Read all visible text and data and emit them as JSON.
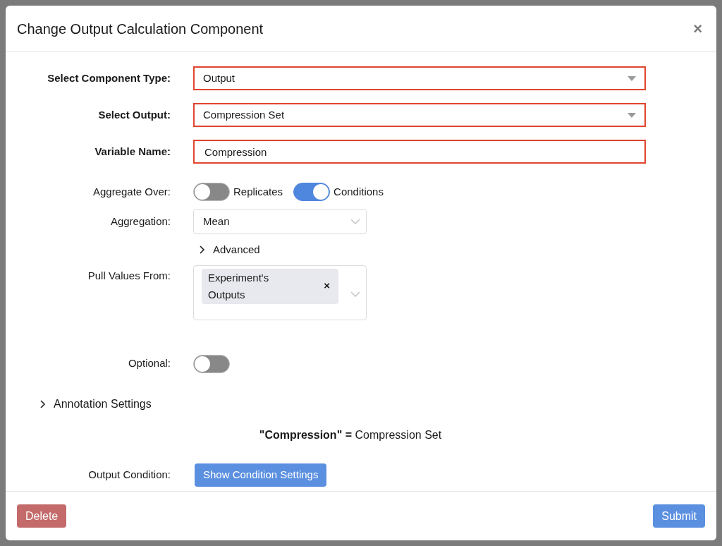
{
  "dialog": {
    "title": "Change Output Calculation Component",
    "close": "×"
  },
  "fields": [
    {
      "kind": "select",
      "label": "Select Component Type:",
      "value": "Output",
      "highlighted": true
    },
    {
      "kind": "select",
      "label": "Select Output:",
      "value": "Compression Set",
      "highlighted": true
    },
    {
      "kind": "input",
      "label": "Variable Name:",
      "value": "Compression",
      "highlighted": true
    },
    {
      "kind": "toggles",
      "label": "Aggregate Over:",
      "toggles": [
        {
          "label": "Replicates",
          "on": false
        },
        {
          "label": "Conditions",
          "on": true
        }
      ]
    },
    {
      "kind": "dropdown",
      "label": "Aggregation:",
      "value": "Mean"
    },
    {
      "kind": "expander",
      "label": "Advanced",
      "expanded": false
    },
    {
      "kind": "multiselect",
      "label": "Pull Values From:",
      "tags": [
        {
          "text": "Experiment's Outputs",
          "remove": "×"
        }
      ]
    },
    {
      "kind": "switch",
      "label": "Optional:",
      "on": false
    }
  ],
  "annotation": {
    "label": "Annotation Settings",
    "expanded": false
  },
  "equation": "**\"Compression\" =** Compression Set",
  "condition": {
    "label": "Output Condition:",
    "button": "Show Condition Settings"
  },
  "footer": {
    "delete": "Delete",
    "submit": "Submit"
  }
}
